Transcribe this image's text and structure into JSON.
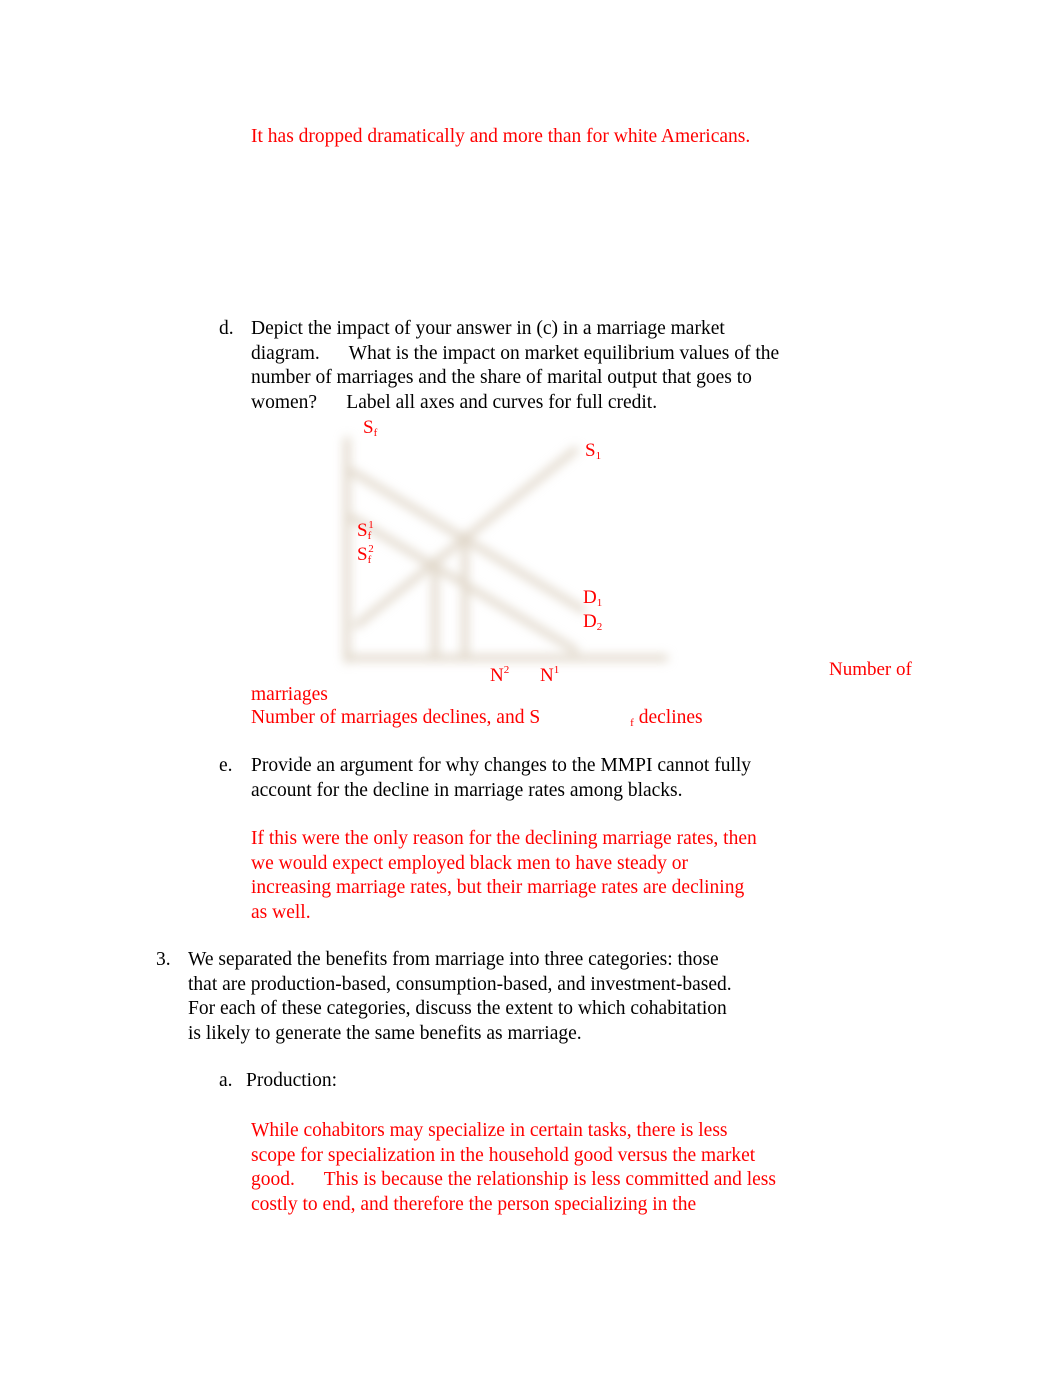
{
  "answer_c": "It has dropped dramatically and more than for white Americans.",
  "question_d": {
    "marker": "d.",
    "lines": [
      "Depict the impact of your answer in (c) in a marriage market",
      "diagram.      What is the impact on market equilibrium values of the",
      "number of marriages and the share of marital output that goes to",
      "women?      Label all axes and curves for full credit."
    ]
  },
  "diagram": {
    "labels": {
      "sf": "S",
      "sf_sub": "f",
      "s1": "S",
      "s1_sub": "1",
      "sf1": "S",
      "sf1_sub": "f",
      "sf1_sup": "1",
      "sf2": "S",
      "sf2_sub": "f",
      "sf2_sup": "2",
      "d1": "D",
      "d1_sub": "1",
      "d2": "D",
      "d2_sub": "2",
      "n2": "N",
      "n2_sup": "2",
      "n1": "N",
      "n1_sup": "1",
      "x_axis_1": "Number of",
      "x_axis_2": "marriages"
    },
    "line_color": "#c8b8a0"
  },
  "answer_d": {
    "text": "Number of marriages declines, and S",
    "sub": "f",
    "tail": " declines"
  },
  "question_e": {
    "marker": "e.",
    "lines": [
      "Provide an argument for why changes to the MMPI cannot fully",
      "account for the decline in marriage rates among blacks."
    ]
  },
  "answer_e": {
    "lines": [
      "If this were the only reason for the declining marriage rates, then",
      "we would expect employed black men to have steady or",
      "increasing marriage rates, but their marriage rates are declining",
      "as well."
    ]
  },
  "question_3": {
    "marker": "3.",
    "lines": [
      "We separated the benefits from marriage into three categories: those",
      "that are production-based, consumption-based, and investment-based.",
      "For each of these categories, discuss the extent to which cohabitation",
      "is likely to generate the same benefits as marriage."
    ]
  },
  "question_3a": {
    "marker": "a.",
    "label": "Production:"
  },
  "answer_3a": {
    "lines": [
      "While cohabitors may specialize in certain tasks, there is less",
      "scope for specialization in the household good versus the market",
      "good.      This is because the relationship is less committed and less",
      "costly to end, and therefore the person specializing in the"
    ]
  }
}
